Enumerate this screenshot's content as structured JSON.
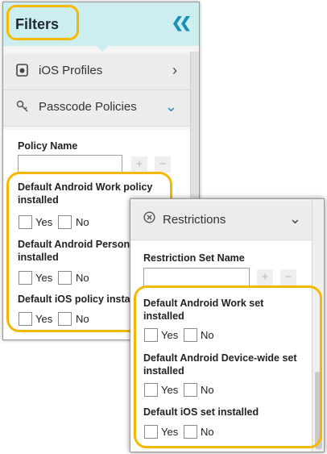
{
  "filters": {
    "title": "Filters",
    "collapse_icon": "double-chevron-left-icon",
    "sections": [
      {
        "label": "iOS Profiles",
        "icon": "apple-device-icon",
        "state": "collapsed"
      },
      {
        "label": "Passcode Policies",
        "icon": "key-icon",
        "state": "expanded"
      }
    ],
    "policy_name_label": "Policy Name",
    "policy_name_value": "",
    "stepper_plus": "+",
    "stepper_minus": "−",
    "questions": [
      {
        "label_line1": "Default Android Work policy",
        "label_line2": "installed"
      },
      {
        "label_line1": "Default Android Persona",
        "label_line2": "installed"
      },
      {
        "label_line1": "Default iOS policy instal",
        "label_line2": ""
      }
    ],
    "yes_label": "Yes",
    "no_label": "No"
  },
  "restrictions": {
    "section_label": "Restrictions",
    "section_icon": "circle-x-icon",
    "state": "expanded",
    "set_name_label": "Restriction Set Name",
    "set_name_value": "",
    "stepper_plus": "+",
    "stepper_minus": "−",
    "questions": [
      {
        "label_line1": "Default Android Work set",
        "label_line2": "installed"
      },
      {
        "label_line1": "Default Android Device-wide set",
        "label_line2": "installed"
      },
      {
        "label_line1": "Default iOS set installed",
        "label_line2": ""
      }
    ],
    "yes_label": "Yes",
    "no_label": "No"
  },
  "colors": {
    "header_bg": "#cdeef0",
    "accent_blue": "#1a8fb8",
    "highlight": "#f5b800"
  }
}
